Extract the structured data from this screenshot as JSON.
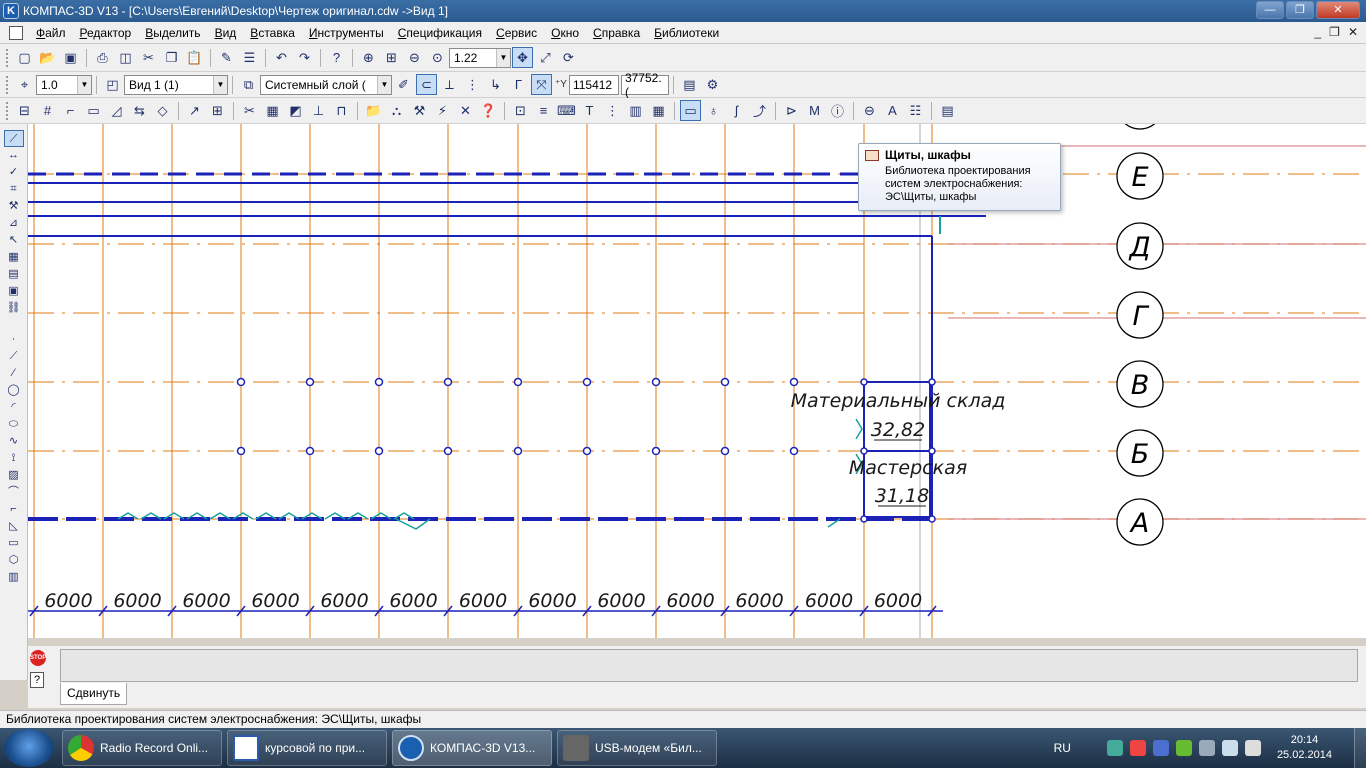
{
  "window": {
    "title": "КОМПАС-3D V13 - [C:\\Users\\Евгений\\Desktop\\Чертеж оригинал.cdw ->Вид 1]",
    "app_icon": "K",
    "controls": {
      "minimize": "—",
      "maximize": "❐",
      "close": "✕"
    }
  },
  "menu": {
    "items": [
      "Файл",
      "Редактор",
      "Выделить",
      "Вид",
      "Вставка",
      "Инструменты",
      "Спецификация",
      "Сервис",
      "Окно",
      "Справка",
      "Библиотеки"
    ],
    "mdi": {
      "minimize": "_",
      "restore": "❐",
      "close": "✕"
    }
  },
  "toolbar1": {
    "icons": [
      "new-icon",
      "open-icon",
      "save-icon",
      "print-icon",
      "preview-icon",
      "cut-icon",
      "copy-icon",
      "paste-icon",
      "brush-icon",
      "properties-icon",
      "undo-icon",
      "redo-icon",
      "help-pointer-icon"
    ],
    "zoom_value": "1.22"
  },
  "toolbar2": {
    "step_value": "1.0",
    "view_value": "Вид 1 (1)",
    "layer_value": "Системный слой (",
    "coord_x": "115412",
    "coord_y": "37752.("
  },
  "tooltip": {
    "title": "Щиты, шкафы",
    "line1": "Библиотека проектирования",
    "line2": "систем электроснабжения:",
    "line3": "ЭС\\Щиты, шкафы"
  },
  "drawing": {
    "axes_letters": [
      "Е",
      "Д",
      "Г",
      "В",
      "Б",
      "А"
    ],
    "dimension_label": "6000",
    "room1_name": "Материальный склад",
    "room1_area": "32,82",
    "room2_name": "Мастерская",
    "room2_area": "31,18",
    "colors": {
      "grid_orange": "#e07a10",
      "walls_blue": "#1a22b8",
      "dim_blue": "#1a22b8",
      "teal": "#1aa0a0",
      "red_line": "#c04040"
    }
  },
  "command_panel": {
    "tab_label": "Сдвинуть",
    "stop_label": "STOP"
  },
  "status": {
    "text": "Библиотека проектирования систем электроснабжения: ЭС\\Щиты, шкафы"
  },
  "taskbar": {
    "tasks": [
      {
        "label": "Radio Record Onli...",
        "icon": "chrome-icon"
      },
      {
        "label": "курсовой по при...",
        "icon": "word-icon"
      },
      {
        "label": "КОМПАС-3D V13...",
        "icon": "kompas-icon"
      },
      {
        "label": "USB-модем «Бил...",
        "icon": "modem-icon"
      }
    ],
    "lang": "RU",
    "time": "20:14",
    "date": "25.02.2014"
  }
}
